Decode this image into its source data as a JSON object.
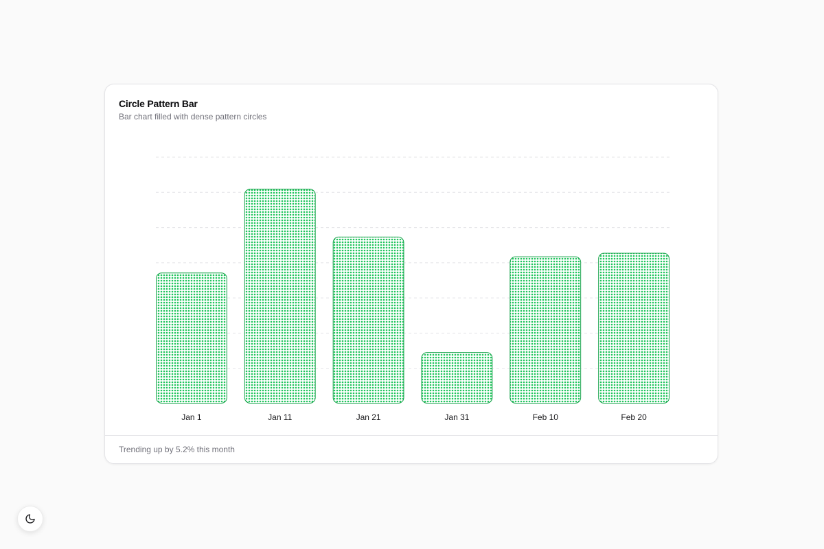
{
  "card": {
    "title": "Circle Pattern Bar",
    "description": "Bar chart filled with dense pattern circles",
    "footer": "Trending up by 5.2% this month"
  },
  "theme_toggle": {
    "icon": "moon-icon"
  },
  "colors": {
    "bar_stroke": "#16a34a",
    "bar_dot": "#22c55e",
    "grid": "#e4e4e7"
  },
  "chart_data": {
    "type": "bar",
    "categories": [
      "Jan 1",
      "Jan 11",
      "Jan 21",
      "Jan 31",
      "Feb 10",
      "Feb 20"
    ],
    "values": [
      186,
      305,
      237,
      73,
      209,
      214
    ],
    "ylim": [
      0,
      350
    ],
    "grid": true,
    "pattern": "dense circles"
  }
}
